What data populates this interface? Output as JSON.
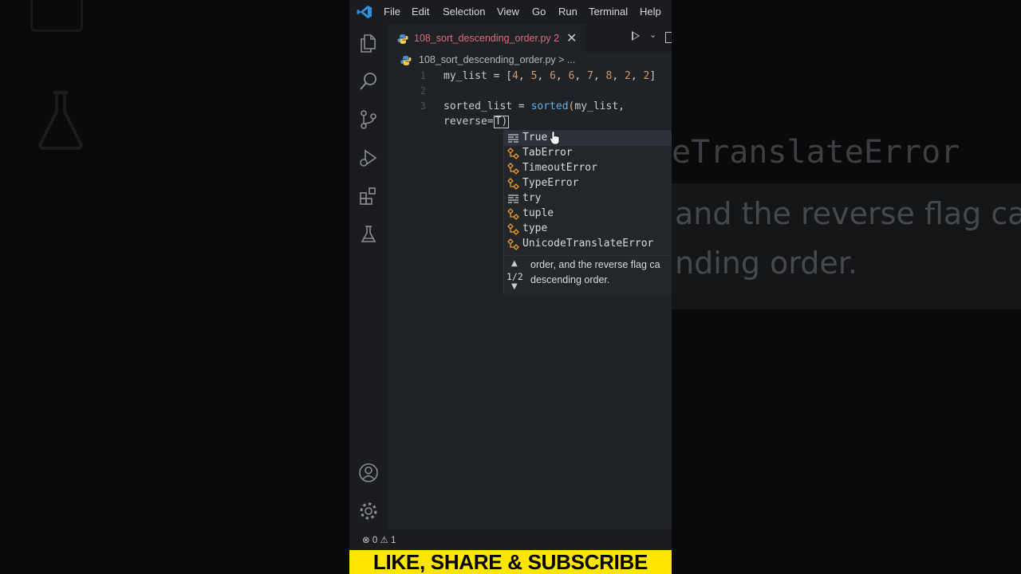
{
  "menubar": {
    "items": [
      "File",
      "Edit",
      "Selection",
      "View",
      "Go",
      "Run",
      "Terminal",
      "Help"
    ]
  },
  "activity_bar": {
    "icons": [
      "explorer-icon",
      "search-icon",
      "source-control-icon",
      "run-debug-icon",
      "extensions-icon",
      "testing-icon",
      "account-icon",
      "settings-gear-icon"
    ]
  },
  "tab": {
    "filename": "108_sort_descending_order.py",
    "problem_count": "2",
    "close_glyph": "✕"
  },
  "breadcrumb": {
    "text": "108_sort_descending_order.py > ..."
  },
  "editor": {
    "lines": [
      {
        "number": "1",
        "text": "my_list = [4, 5, 6, 6, 7, 8, 2, 2]"
      },
      {
        "number": "2",
        "text": ""
      },
      {
        "number": "3",
        "text": "sorted_list = sorted(my_list,"
      },
      {
        "number": "",
        "text": "reverse=T)"
      }
    ]
  },
  "suggestions": {
    "items": [
      {
        "label": "True",
        "kind": "keyword-icon",
        "selected": true
      },
      {
        "label": "TabError",
        "kind": "class-icon",
        "selected": false
      },
      {
        "label": "TimeoutError",
        "kind": "class-icon",
        "selected": false
      },
      {
        "label": "TypeError",
        "kind": "class-icon",
        "selected": false
      },
      {
        "label": "try",
        "kind": "keyword-icon",
        "selected": false
      },
      {
        "label": "tuple",
        "kind": "class-icon",
        "selected": false
      },
      {
        "label": "type",
        "kind": "class-icon",
        "selected": false
      },
      {
        "label": "UnicodeTranslateError",
        "kind": "class-icon",
        "selected": false
      }
    ]
  },
  "signature_help": {
    "page": "1/2",
    "doc_line1": "order, and the reverse flag ca",
    "doc_line2": "descending order."
  },
  "status_bar": {
    "errors": "0",
    "warnings": "1"
  },
  "background": {
    "code_fragment": "eTranslateError",
    "doc_line1": "and the reverse flag ca",
    "doc_line2": "nding order."
  },
  "banner": {
    "text": "LIKE, SHARE & SUBSCRIBE"
  },
  "colors": {
    "editor_bg": "#1f2227",
    "tab_error_text": "#e06c75",
    "number": "#d19a66",
    "function": "#61afef",
    "banner_bg": "#ffe600",
    "class_icon": "#ee9d28"
  }
}
